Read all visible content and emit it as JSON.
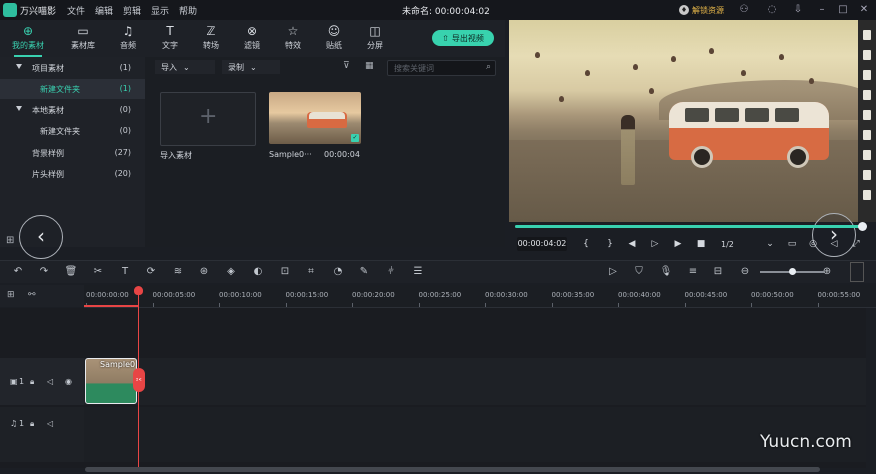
{
  "app": {
    "name": "万兴喵影",
    "menus": [
      "文件",
      "编辑",
      "剪辑",
      "显示",
      "帮助"
    ],
    "title": "未命名: 00:00:04:02",
    "unlock_label": "解锁资源",
    "window_icons": [
      "user-icon",
      "message-icon",
      "download-icon",
      "minimize-icon",
      "maximize-icon",
      "close-icon"
    ]
  },
  "tabs": [
    {
      "label": "我的素材",
      "icon": "folder-icon",
      "active": true
    },
    {
      "label": "素材库",
      "icon": "library-icon"
    },
    {
      "label": "音频",
      "icon": "music-icon"
    },
    {
      "label": "文字",
      "icon": "text-icon"
    },
    {
      "label": "转场",
      "icon": "transition-icon"
    },
    {
      "label": "滤镜",
      "icon": "filter-icon"
    },
    {
      "label": "特效",
      "icon": "effects-icon"
    },
    {
      "label": "贴纸",
      "icon": "sticker-icon"
    },
    {
      "label": "分屏",
      "icon": "splitscreen-icon"
    }
  ],
  "export_label": "导出视频",
  "library": [
    {
      "name": "项目素材",
      "count": "(1)",
      "expandable": true
    },
    {
      "name": "新建文件夹",
      "count": "(1)",
      "selected": true
    },
    {
      "name": "本地素材",
      "count": "(0)",
      "expandable": true
    },
    {
      "name": "新建文件夹",
      "count": "(0)"
    },
    {
      "name": "背景样例",
      "count": "(27)"
    },
    {
      "name": "片头样例",
      "count": "(20)"
    }
  ],
  "media": {
    "import_dropdown": "导入",
    "record_dropdown": "录制",
    "search_placeholder": "搜索关键词",
    "tiles": [
      {
        "caption": "导入素材"
      },
      {
        "caption": "Sample0···",
        "duration": "00:00:04"
      }
    ]
  },
  "player": {
    "timecode": "00:00:04:02",
    "progress": 1.0,
    "quality": "1/2"
  },
  "timeline": {
    "ruler_ticks": [
      "00:00:00:00",
      "00:00:05:00",
      "00:00:10:00",
      "00:00:15:00",
      "00:00:20:00",
      "00:00:25:00",
      "00:00:30:00",
      "00:00:35:00",
      "00:00:40:00",
      "00:00:45:00",
      "00:00:50:00",
      "00:00:55:00"
    ],
    "video_track_label": "1",
    "audio_track_label": "1",
    "clip_label": "Sample0",
    "zoom_level": 0.5
  },
  "watermark": "Yuucn.com"
}
